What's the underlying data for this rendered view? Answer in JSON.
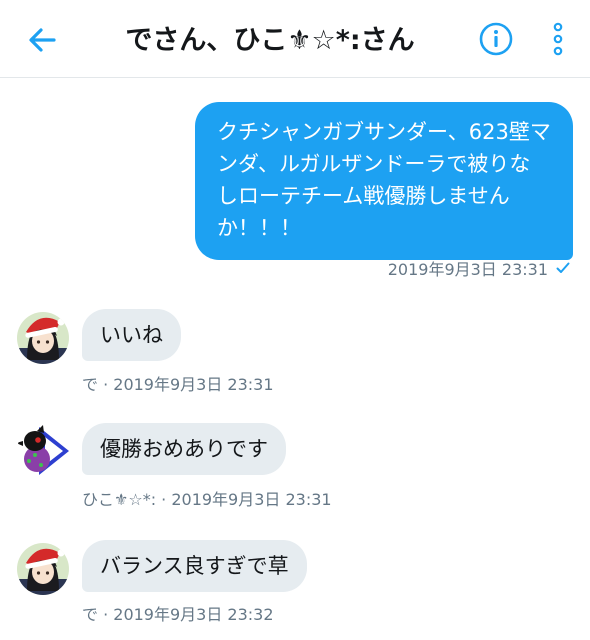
{
  "header": {
    "title": "でさん、ひこ⚜☆*:さん"
  },
  "outgoing": {
    "text": "クチシャンガブサンダー、623壁マンダ、ルガルザンドーラで被りなしローテチーム戦優勝しませんか！！！",
    "timestamp": "2019年9月3日 23:31",
    "status_icon": "check-icon"
  },
  "incoming": [
    {
      "text": "いいね",
      "meta": "で · 2019年9月3日 23:31"
    },
    {
      "text": "優勝おめありです",
      "meta": "ひこ⚜☆*: · 2019年9月3日 23:31"
    },
    {
      "text": "バランス良すぎで草",
      "meta": "で · 2019年9月3日 23:32"
    }
  ],
  "colors": {
    "accent": "#1da1f2",
    "bubble_in": "#e6ecf0",
    "meta_text": "#657786"
  }
}
